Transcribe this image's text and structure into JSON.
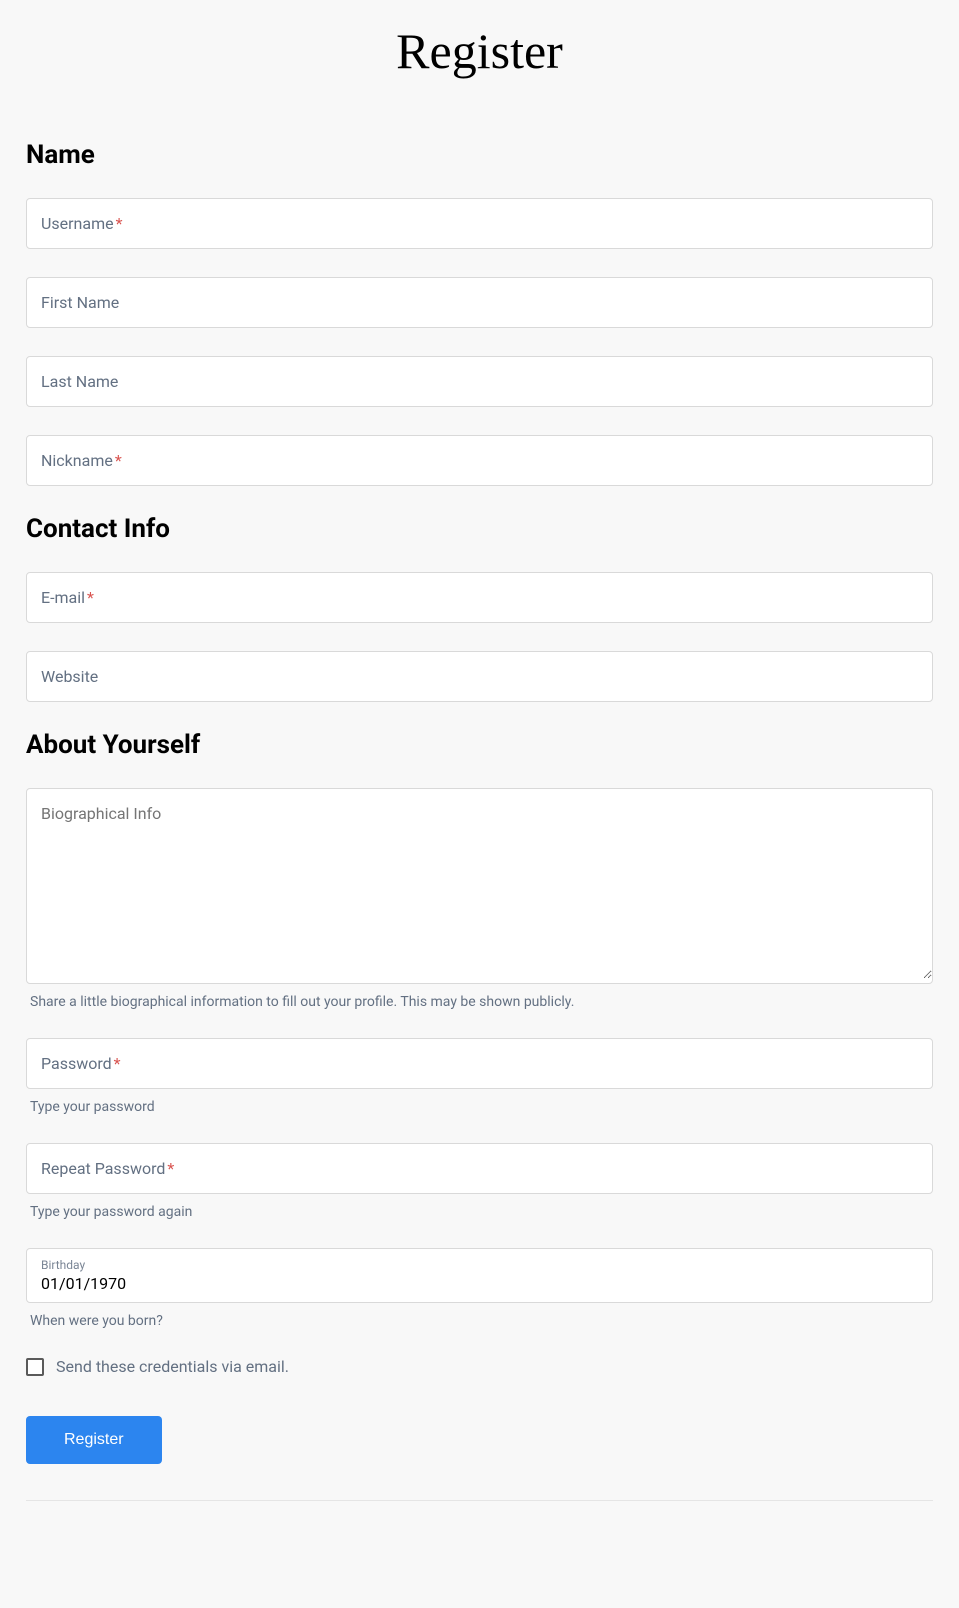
{
  "page": {
    "title": "Register"
  },
  "sections": {
    "name": {
      "heading": "Name"
    },
    "contact": {
      "heading": "Contact Info"
    },
    "about": {
      "heading": "About Yourself"
    }
  },
  "fields": {
    "username": {
      "label": "Username",
      "required": true
    },
    "first_name": {
      "label": "First Name",
      "required": false
    },
    "last_name": {
      "label": "Last Name",
      "required": false
    },
    "nickname": {
      "label": "Nickname",
      "required": true
    },
    "email": {
      "label": "E-mail",
      "required": true
    },
    "website": {
      "label": "Website",
      "required": false
    },
    "bio": {
      "label": "Biographical Info",
      "help": "Share a little biographical information to fill out your profile. This may be shown publicly."
    },
    "password": {
      "label": "Password",
      "required": true,
      "help": "Type your password"
    },
    "repeat_password": {
      "label": "Repeat Password",
      "required": true,
      "help": "Type your password again"
    },
    "birthday": {
      "label": "Birthday",
      "value": "01/01/1970",
      "help": "When were you born?"
    },
    "send_email": {
      "label": "Send these credentials via email.",
      "checked": false
    }
  },
  "required_marker": "*",
  "submit": {
    "label": "Register"
  }
}
